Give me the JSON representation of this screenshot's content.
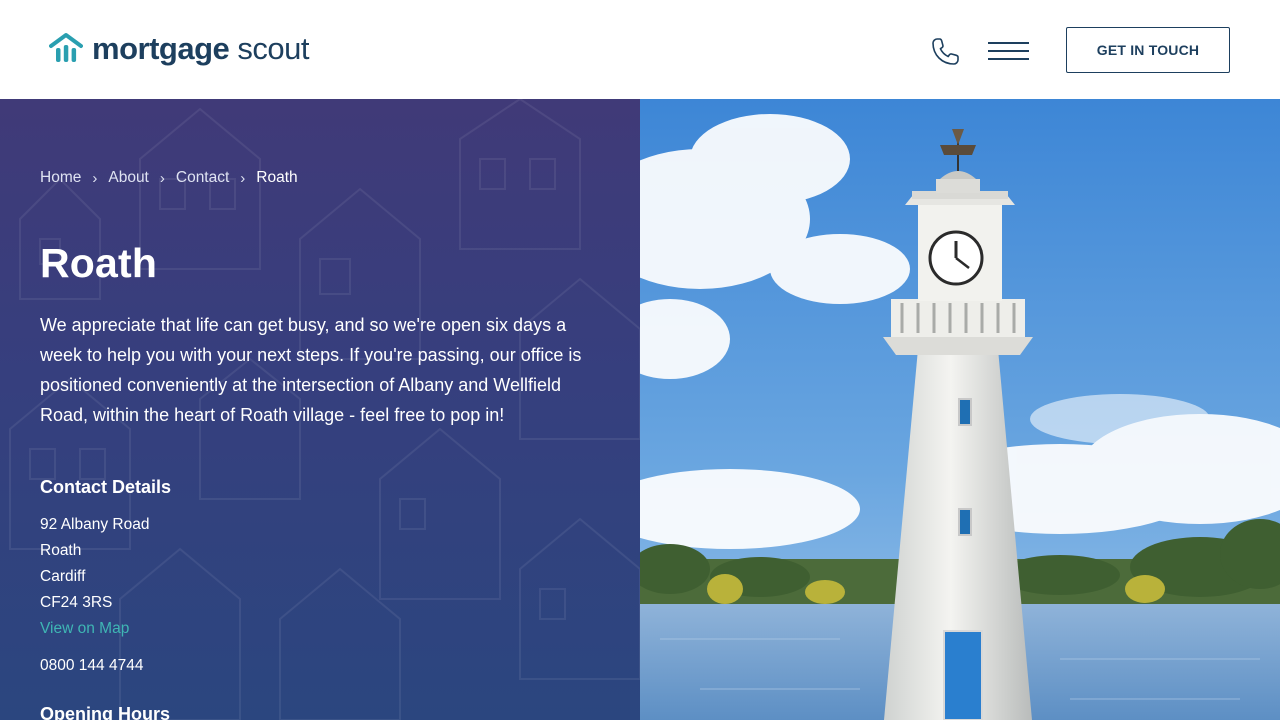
{
  "header": {
    "logo": {
      "word_bold": "mortgage",
      "word_light": "scout"
    },
    "cta_label": "GET IN TOUCH",
    "colors": {
      "brand_navy": "#1d3f5e",
      "brand_teal": "#2a9fb0"
    }
  },
  "breadcrumb": {
    "items": [
      "Home",
      "About",
      "Contact"
    ],
    "current": "Roath",
    "separator": "›"
  },
  "main": {
    "title": "Roath",
    "intro": "We appreciate that life can get busy, and so we're open six days a week to help you with your next steps. If you're passing, our office is positioned conveniently at the intersection of Albany and Wellfield Road, within the heart of Roath village - feel free to pop in!",
    "contact_heading": "Contact Details",
    "address": [
      "92 Albany Road",
      "Roath",
      "Cardiff",
      "CF24 3RS"
    ],
    "map_link": "View on Map",
    "phone": "0800 144 4744",
    "hours_heading": "Opening Hours",
    "colors": {
      "panel_top": "#403a78",
      "panel_bottom": "#2b467f",
      "link": "#3fb6b4"
    }
  }
}
